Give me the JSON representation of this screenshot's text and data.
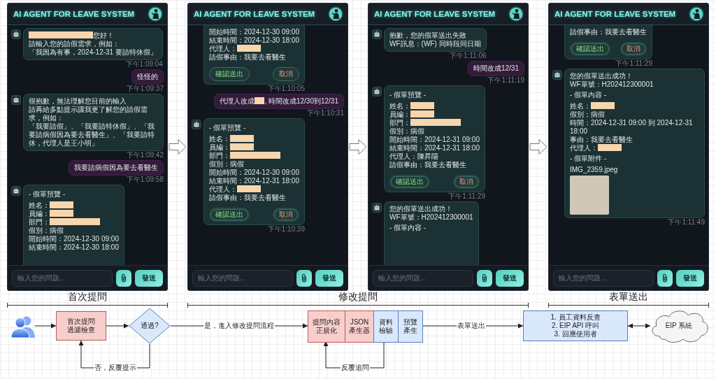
{
  "stages": [
    {
      "title": "首次提問",
      "screens": [
        {
          "title": "AI AGENT FOR LEAVE SYSTEM",
          "messages": [
            {
              "kind": "bot",
              "lines": [
                [
                  {
                    "kind": "widemask"
                  },
                  {
                    "kind": "text",
                    "text": "您好！"
                  }
                ],
                "請輸入您的請假需求，例如：",
                "「我因為有事，2024-12-31 要請特休假」"
              ],
              "time": "下午1:09:04"
            },
            {
              "kind": "user",
              "lines": [
                "怪怪的"
              ],
              "time": "下午1:09:37"
            },
            {
              "kind": "bot",
              "lines": [
                "很抱歉，無法理解您目前的輸入",
                "請再給多點提示讓我更了解您的請假需求，例如：",
                "「我要請假」、「我要請特休假」、「我要請病假因為要去看醫生」、「我要請特休，代理人是王小明」"
              ],
              "time": "下午1:09:42"
            },
            {
              "kind": "user",
              "lines": [
                "我要請病假因為要去看醫生"
              ],
              "time": "下午1:09:58"
            },
            {
              "kind": "bot",
              "cut_bottom": true,
              "lines": [
                {
                  "kind": "heading",
                  "text": "- 假單預覽 -"
                },
                [
                  {
                    "kind": "text",
                    "text": "姓名："
                  },
                  {
                    "kind": "mask"
                  }
                ],
                [
                  {
                    "kind": "text",
                    "text": "員編："
                  },
                  {
                    "kind": "mask"
                  }
                ],
                [
                  {
                    "kind": "text",
                    "text": "部門："
                  },
                  {
                    "kind": "longmask"
                  }
                ],
                "假別：病假",
                "開始時間：2024-12-30 09:00",
                "結束時間：2024-12-30 18:00"
              ]
            }
          ],
          "input": {
            "placeholder": "輸入您的問題..."
          },
          "send_button": "發送"
        }
      ]
    },
    {
      "title": "修改提問",
      "screens": [
        {
          "title": "AI AGENT FOR LEAVE SYSTEM",
          "messages": [
            {
              "kind": "bot",
              "cut_top": true,
              "lines": [
                "開始時間：2024-12-30 09:00",
                "結束時間：2024-12-30 18:00",
                [
                  {
                    "kind": "text",
                    "text": "代理人："
                  },
                  {
                    "kind": "mask"
                  }
                ],
                "請假事由：我要去看醫生"
              ],
              "actions": [
                {
                  "kind": "confirm",
                  "label": "確認送出",
                  "glow": false
                },
                {
                  "kind": "cancel",
                  "label": "取消",
                  "glow": false
                }
              ],
              "time": "下午1:10:05"
            },
            {
              "kind": "user",
              "lines": [
                [
                  {
                    "kind": "text",
                    "text": "代理人改成"
                  },
                  {
                    "kind": "tinymask"
                  },
                  {
                    "kind": "text",
                    "text": ", 時間改成12/30到12/31"
                  }
                ]
              ],
              "time": "下午1:10:31"
            },
            {
              "kind": "bot",
              "lines": [
                {
                  "kind": "heading",
                  "text": "- 假單預覽 -"
                },
                [
                  {
                    "kind": "text",
                    "text": "姓名："
                  },
                  {
                    "kind": "mask"
                  }
                ],
                [
                  {
                    "kind": "text",
                    "text": "員編："
                  },
                  {
                    "kind": "mask"
                  }
                ],
                [
                  {
                    "kind": "text",
                    "text": "部門："
                  },
                  {
                    "kind": "longmask"
                  }
                ],
                "假別：病假",
                "開始時間：2024-12-30 09:00",
                "結束時間：2024-12-31 18:00",
                [
                  {
                    "kind": "text",
                    "text": "代理人："
                  },
                  {
                    "kind": "mask"
                  }
                ],
                "請假事由：我要去看醫生"
              ],
              "actions": [
                {
                  "kind": "confirm",
                  "label": "確認送出",
                  "glow": true
                },
                {
                  "kind": "cancel",
                  "label": "取消",
                  "glow": true
                }
              ],
              "time": "下午1:10:39"
            }
          ],
          "input": {
            "placeholder": "輸入您的問題..."
          },
          "send_button": "發送"
        },
        {
          "title": "AI AGENT FOR LEAVE SYSTEM",
          "messages": [
            {
              "kind": "bot",
              "lines": [
                "抱歉，您的假單送出失敗",
                "WF訊息：(WF) 同時段同日期"
              ],
              "time": "下午1:11:06"
            },
            {
              "kind": "user",
              "lines": [
                "時間改成12/31"
              ],
              "time": "下午1:11:19"
            },
            {
              "kind": "bot",
              "lines": [
                {
                  "kind": "heading",
                  "text": "- 假單預覽 -"
                },
                [
                  {
                    "kind": "text",
                    "text": "姓名："
                  },
                  {
                    "kind": "mask"
                  }
                ],
                [
                  {
                    "kind": "text",
                    "text": "員編："
                  },
                  {
                    "kind": "mask"
                  }
                ],
                [
                  {
                    "kind": "text",
                    "text": "部門："
                  },
                  {
                    "kind": "longmask"
                  }
                ],
                "假別：病假",
                "開始時間：2024-12-31 09:00",
                "結束時間：2024-12-31 18:00",
                "代理人：陳昇陽",
                "請假事由：我要去看醫生"
              ],
              "actions": [
                {
                  "kind": "confirm",
                  "label": "確認送出",
                  "glow": true
                },
                {
                  "kind": "cancel",
                  "label": "取消",
                  "glow": true
                }
              ],
              "time": "下午1:11:29"
            },
            {
              "kind": "bot",
              "cut_bottom": true,
              "lines": [
                "您的假單送出成功！",
                "WF單號：H202412300001",
                {
                  "kind": "heading",
                  "text": "- 假單內容 -"
                }
              ]
            }
          ],
          "input": {
            "placeholder": "輸入您的問題..."
          },
          "send_button": "發送"
        }
      ]
    },
    {
      "title": "表單送出",
      "screens": [
        {
          "title": "AI AGENT FOR LEAVE SYSTEM",
          "messages": [
            {
              "kind": "bot",
              "cut_top": true,
              "lines": [
                "請假事由：我要去看醫生"
              ],
              "actions": [
                {
                  "kind": "confirm",
                  "label": "確認送出",
                  "glow": true
                },
                {
                  "kind": "cancel",
                  "label": "取消",
                  "glow": true
                }
              ],
              "time": "下午1:11:29"
            },
            {
              "kind": "bot",
              "lines": [
                "您的假單送出成功！",
                "WF單號：H202412300001",
                {
                  "kind": "heading",
                  "text": "- 假單內容 -"
                },
                [
                  {
                    "kind": "text",
                    "text": "姓名："
                  },
                  {
                    "kind": "mask"
                  }
                ],
                "假別：病假",
                "時間：2024-12-31 09:00 到 2024-12-31 18:00",
                "事由：我要去看醫生",
                [
                  {
                    "kind": "text",
                    "text": "代理人："
                  },
                  {
                    "kind": "mask"
                  }
                ],
                {
                  "kind": "heading",
                  "text": "- 假單附件 -"
                },
                "IMG_2359.jpeg"
              ],
              "photo": true,
              "time": "下午1:11:49"
            }
          ],
          "input": {
            "placeholder": "輸入您的問題..."
          },
          "send_button": "發送"
        }
      ]
    }
  ],
  "flow": {
    "nodes": [
      {
        "kind": "actor"
      },
      {
        "kind": "process",
        "lines": [
          "首次提問",
          "過濾檢查"
        ],
        "color": "#f8cecc"
      },
      {
        "kind": "decision",
        "text": "通過?",
        "color": "#dae8fc"
      },
      {
        "kind": "group",
        "parts": [
          {
            "lines": [
              "提問內容",
              "正規化"
            ],
            "color": "#f8cecc"
          },
          {
            "lines": [
              "JSON",
              "產生器"
            ],
            "color": "#f8cecc"
          },
          {
            "lines": [
              "資料",
              "檢驗"
            ],
            "color": "#dae8fc"
          },
          {
            "lines": [
              "預覽",
              "產生"
            ],
            "color": "#dae8fc"
          }
        ]
      },
      {
        "kind": "process",
        "lines": [
          "1. 員工資料反查",
          "2. EIP API 呼叫",
          "3. 回應使用者"
        ],
        "color": "#dae8fc"
      },
      {
        "kind": "cloud",
        "text": "EIP 系統"
      }
    ],
    "edges": [
      {
        "kind": "forward"
      },
      {
        "kind": "forward"
      },
      {
        "kind": "forward",
        "label": "是，進入修改提問流程"
      },
      {
        "kind": "loop",
        "label": "否，反覆提示"
      },
      {
        "kind": "loop",
        "label": "反覆追問"
      },
      {
        "kind": "forward",
        "label": "表單送出"
      },
      {
        "kind": "both_ways"
      }
    ]
  }
}
